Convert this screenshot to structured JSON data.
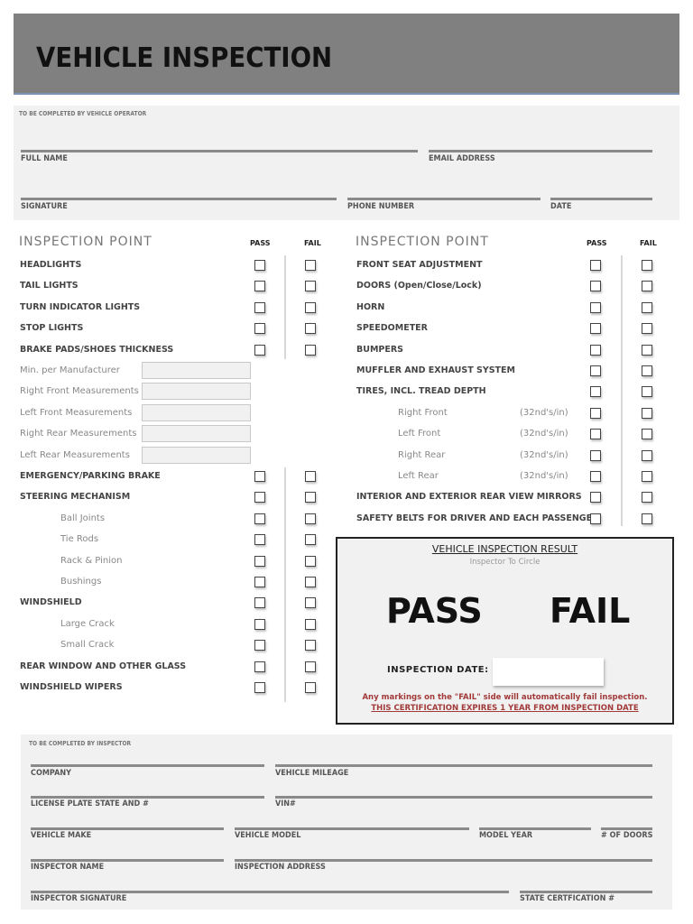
{
  "header": {
    "title": "VEHICLE INSPECTION"
  },
  "operator": {
    "caption": "TO BE COMPLETED BY VEHICLE OPERATOR",
    "fields": {
      "full_name": "FULL NAME",
      "email": "EMAIL ADDRESS",
      "signature": "SIGNATURE",
      "phone": "PHONE NUMBER",
      "date": "DATE"
    }
  },
  "left_table": {
    "heading": "INSPECTION POINT",
    "pass": "PASS",
    "fail": "FAIL",
    "items": [
      "HEADLIGHTS",
      "TAIL LIGHTS",
      "TURN INDICATOR LIGHTS",
      "STOP LIGHTS",
      "BRAKE PADS/SHOES THICKNESS",
      "EMERGENCY/PARKING BRAKE",
      "STEERING MECHANISM",
      "Ball Joints",
      "Tie Rods",
      "Rack & Pinion",
      "Bushings",
      "WINDSHIELD",
      "Large Crack",
      "Small Crack",
      "REAR WINDOW AND OTHER GLASS",
      "WINDSHIELD WIPERS"
    ],
    "measurements": [
      "Min. per Manufacturer",
      "Right Front Measurements",
      "Left Front Measurements",
      "Right Rear Measurements",
      "Left Rear Measurements"
    ]
  },
  "right_table": {
    "heading": "INSPECTION POINT",
    "pass": "PASS",
    "fail": "FAIL",
    "items": [
      "FRONT SEAT ADJUSTMENT",
      "DOORS (Open/Close/Lock)",
      "HORN",
      "SPEEDOMETER",
      "BUMPERS",
      "MUFFLER AND EXHAUST SYSTEM",
      "TIRES, INCL. TREAD DEPTH",
      "Right Front",
      "Left Front",
      "Right Rear",
      "Left Rear",
      "INTERIOR AND EXTERIOR REAR VIEW MIRRORS",
      "SAFETY BELTS FOR DRIVER AND EACH PASSENGER"
    ],
    "unit": "(32nd's/in)"
  },
  "result": {
    "title": "VEHICLE INSPECTION RESULT",
    "subtitle": "Inspector To Circle",
    "pass": "PASS",
    "fail": "FAIL",
    "date_label": "INSPECTION DATE:",
    "date_value": "",
    "warning": "Any markings on the \"FAIL\" side will automatically fail inspection.",
    "expiry": "THIS CERTIFICATION EXPIRES 1 YEAR FROM INSPECTION DATE"
  },
  "inspector": {
    "caption": "TO BE COMPLETED BY INSPECTOR",
    "fields": {
      "company": "COMPANY",
      "mileage": "VEHICLE MILEAGE",
      "plate": "LICENSE PLATE STATE AND #",
      "vin": "VIN#",
      "make": "VEHICLE MAKE",
      "model": "VEHICLE MODEL",
      "year": "MODEL YEAR",
      "doors": "# OF DOORS",
      "inspector_name": "INSPECTOR NAME",
      "address": "INSPECTION ADDRESS",
      "inspector_signature": "INSPECTOR SIGNATURE",
      "cert": "STATE CERTFICATION #"
    }
  }
}
